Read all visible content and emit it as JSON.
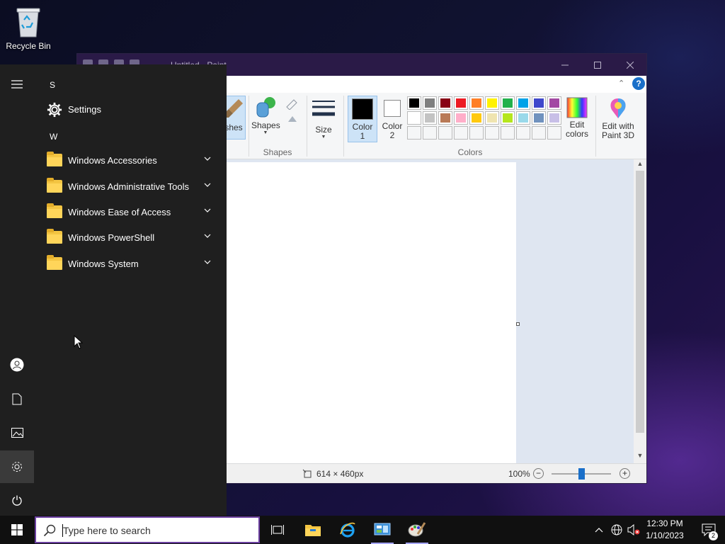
{
  "desktop": {
    "recycle_bin_label": "Recycle Bin"
  },
  "paint": {
    "window_title": "Untitled - Paint",
    "brushes_label_partial": "shes",
    "shapes_button_label": "Shapes",
    "shapes_group_label": "Shapes",
    "size_label": "Size",
    "color1_label_line1": "Color",
    "color1_label_line2": "1",
    "color2_label_line1": "Color",
    "color2_label_line2": "2",
    "colors_group_label": "Colors",
    "edit_colors_line1": "Edit",
    "edit_colors_line2": "colors",
    "paint3d_line1": "Edit with",
    "paint3d_line2": "Paint 3D",
    "help_label": "?",
    "color1_value": "#000000",
    "color2_value": "#ffffff",
    "palette_row1": [
      "#000000",
      "#7f7f7f",
      "#880015",
      "#ed1c24",
      "#ff7f27",
      "#fff200",
      "#22b14c",
      "#00a2e8",
      "#3f48cc",
      "#a349a4"
    ],
    "palette_row2": [
      "#ffffff",
      "#c3c3c3",
      "#b97a57",
      "#ffaec9",
      "#ffc90e",
      "#efe4b0",
      "#b5e61d",
      "#99d9ea",
      "#7092be",
      "#c8bfe7"
    ],
    "canvas_size": "614 × 460px",
    "zoom_level": "100%"
  },
  "start_menu": {
    "section_s": "S",
    "section_w": "W",
    "items": [
      {
        "label": "Settings",
        "type": "app",
        "icon": "gear-icon"
      },
      {
        "label": "Windows Accessories",
        "type": "folder",
        "icon": "folder-icon"
      },
      {
        "label": "Windows Administrative Tools",
        "type": "folder",
        "icon": "folder-icon"
      },
      {
        "label": "Windows Ease of Access",
        "type": "folder",
        "icon": "folder-icon"
      },
      {
        "label": "Windows PowerShell",
        "type": "folder",
        "icon": "folder-icon"
      },
      {
        "label": "Windows System",
        "type": "folder",
        "icon": "folder-icon"
      }
    ],
    "rail": [
      "hamburger-icon",
      "user-icon",
      "documents-icon",
      "pictures-icon",
      "settings-icon",
      "power-icon"
    ]
  },
  "taskbar": {
    "search_placeholder": "Type here to search",
    "pinned_apps": [
      "task-view-icon",
      "file-explorer-icon",
      "internet-explorer-icon",
      "control-panel-icon",
      "paint-icon"
    ],
    "clock_time": "12:30 PM",
    "clock_date": "1/10/2023",
    "notification_count": "2"
  },
  "colors": {
    "accent": "#6b3fa0",
    "start_menu_bg": "#1f1f1f",
    "taskbar_bg": "#101010"
  }
}
